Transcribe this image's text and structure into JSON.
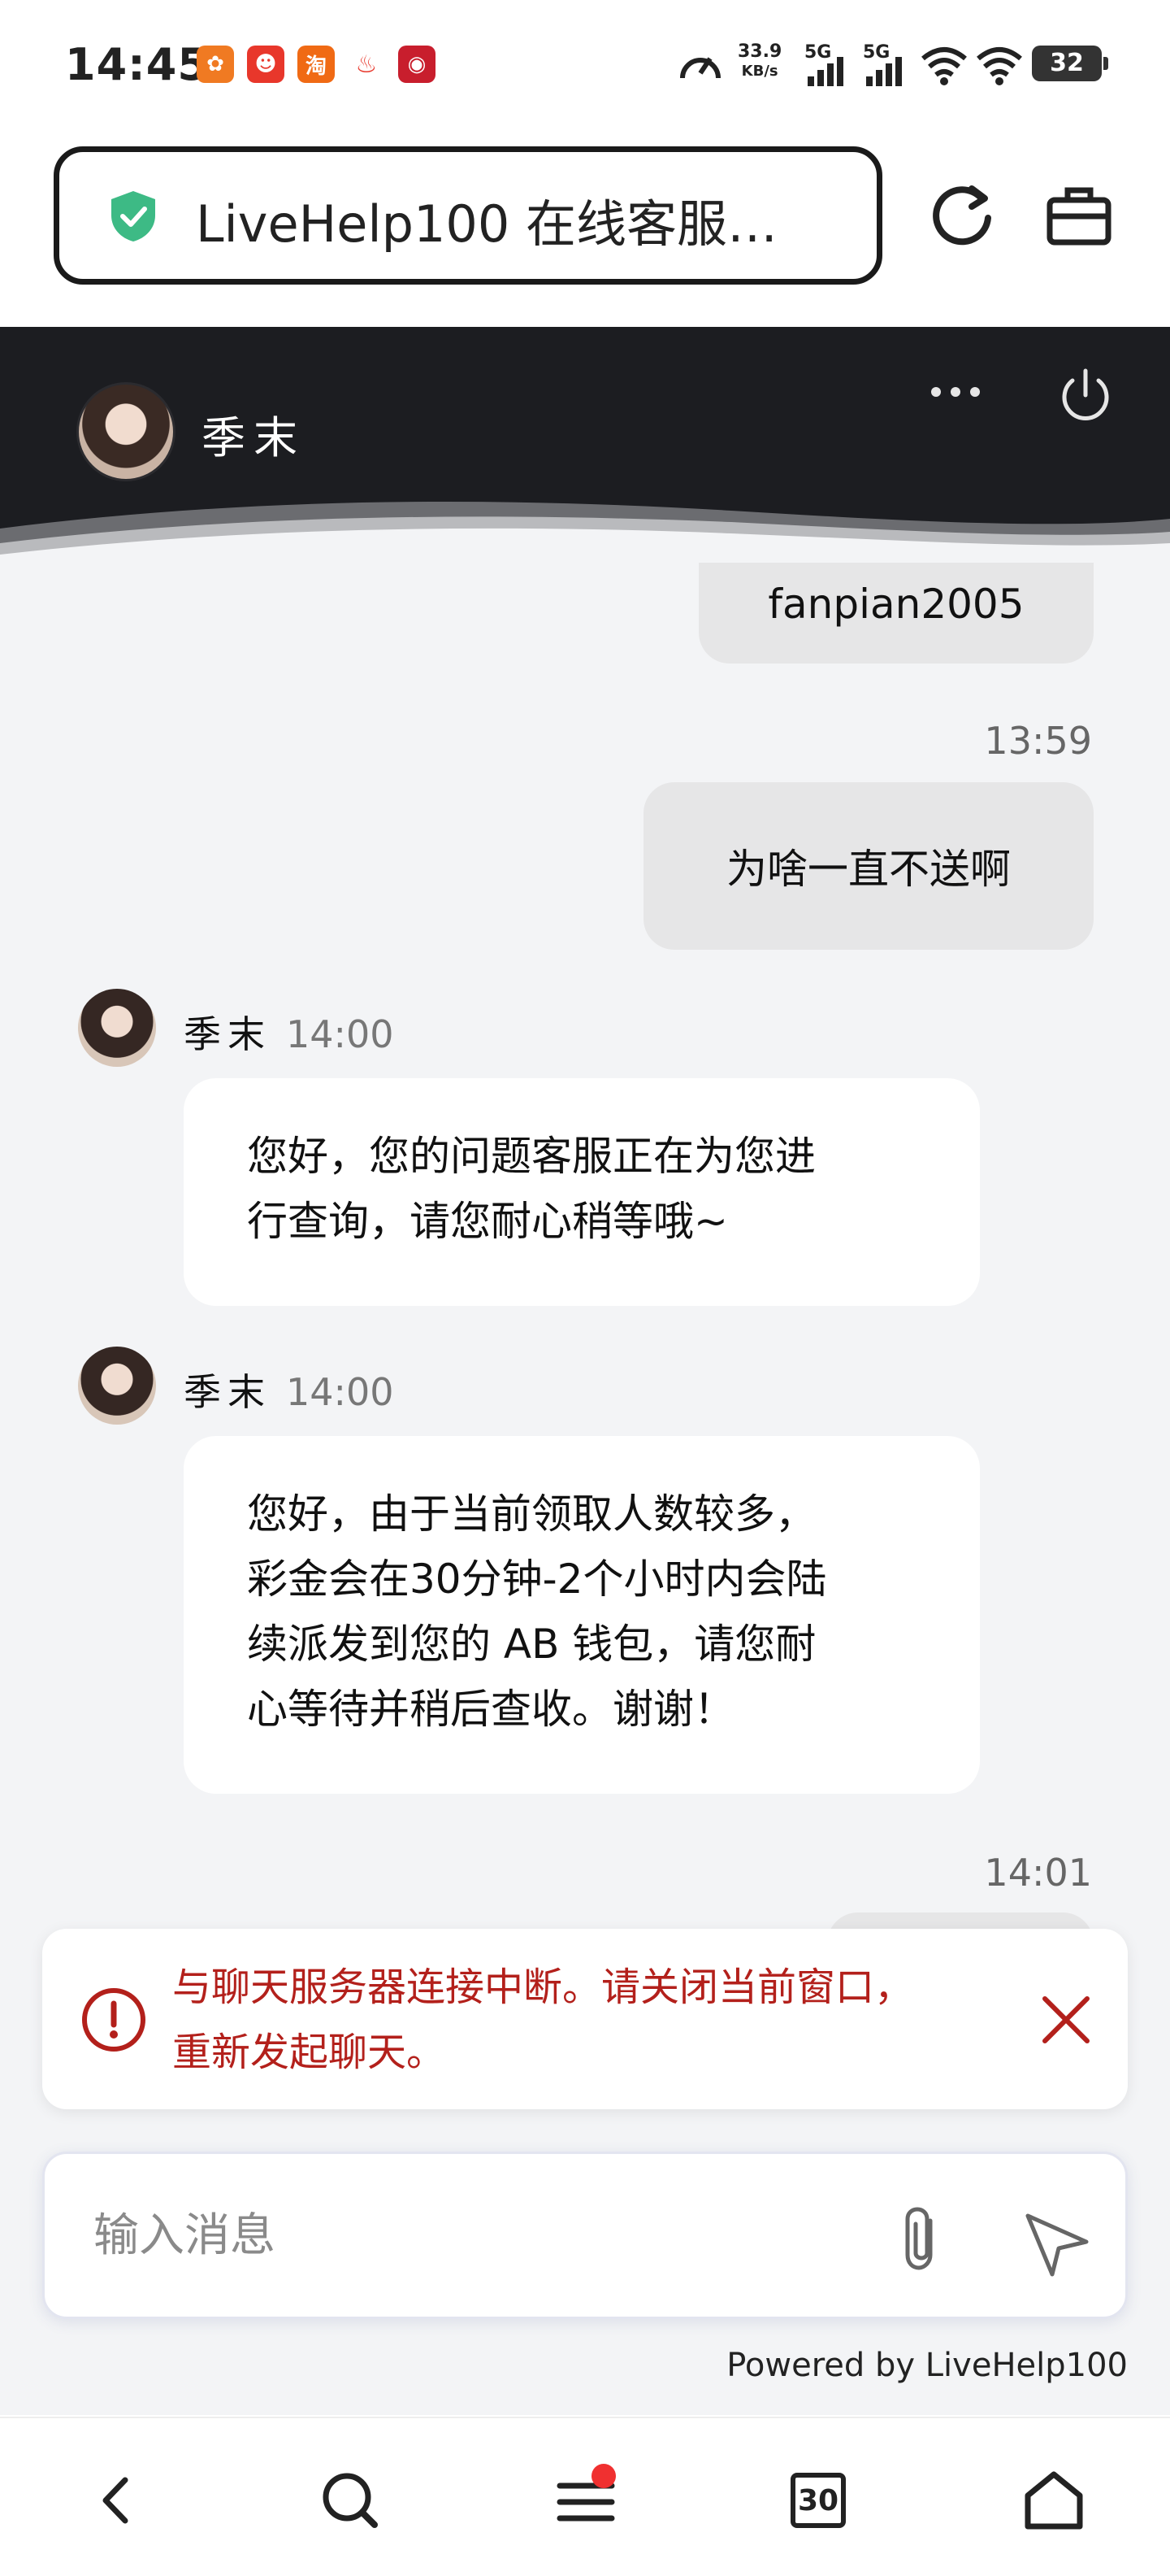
{
  "status_bar": {
    "time": "14:45",
    "net_speed_value": "33.9",
    "net_speed_unit": "KB/s",
    "sim1": "5G",
    "sim2": "5G",
    "battery": "32"
  },
  "browser": {
    "url_title": "LiveHelp100 在线客服…"
  },
  "chat_header": {
    "agent_name": "季末"
  },
  "messages": [
    {
      "direction": "out",
      "text": "fanpian2005"
    },
    {
      "direction": "out",
      "time": "13:59",
      "text": "为啥一直不送啊"
    },
    {
      "direction": "in",
      "name": "季末",
      "time": "14:00",
      "lines": [
        "您好，您的问题客服正在为您进",
        "行查询，请您耐心稍等哦~"
      ]
    },
    {
      "direction": "in",
      "name": "季末",
      "time": "14:00",
      "lines": [
        "您好，由于当前领取人数较多，",
        "彩金会在30分钟-2个小时内会陆",
        "续派发到您的 AB 钱包，请您耐",
        "心等待并稍后查收。谢谢！"
      ]
    },
    {
      "direction": "out",
      "time": "14:01"
    }
  ],
  "error": {
    "lines": [
      "与聊天服务器连接中断。请关闭当前窗口，",
      "重新发起聊天。"
    ]
  },
  "composer": {
    "placeholder": "输入消息"
  },
  "footer": {
    "powered_by": "Powered by LiveHelp100"
  },
  "bottom_nav": {
    "tab_count": "30"
  },
  "colors": {
    "header_bg": "#1c1d21",
    "error_red": "#b3201b",
    "shield_green": "#3dba85"
  }
}
